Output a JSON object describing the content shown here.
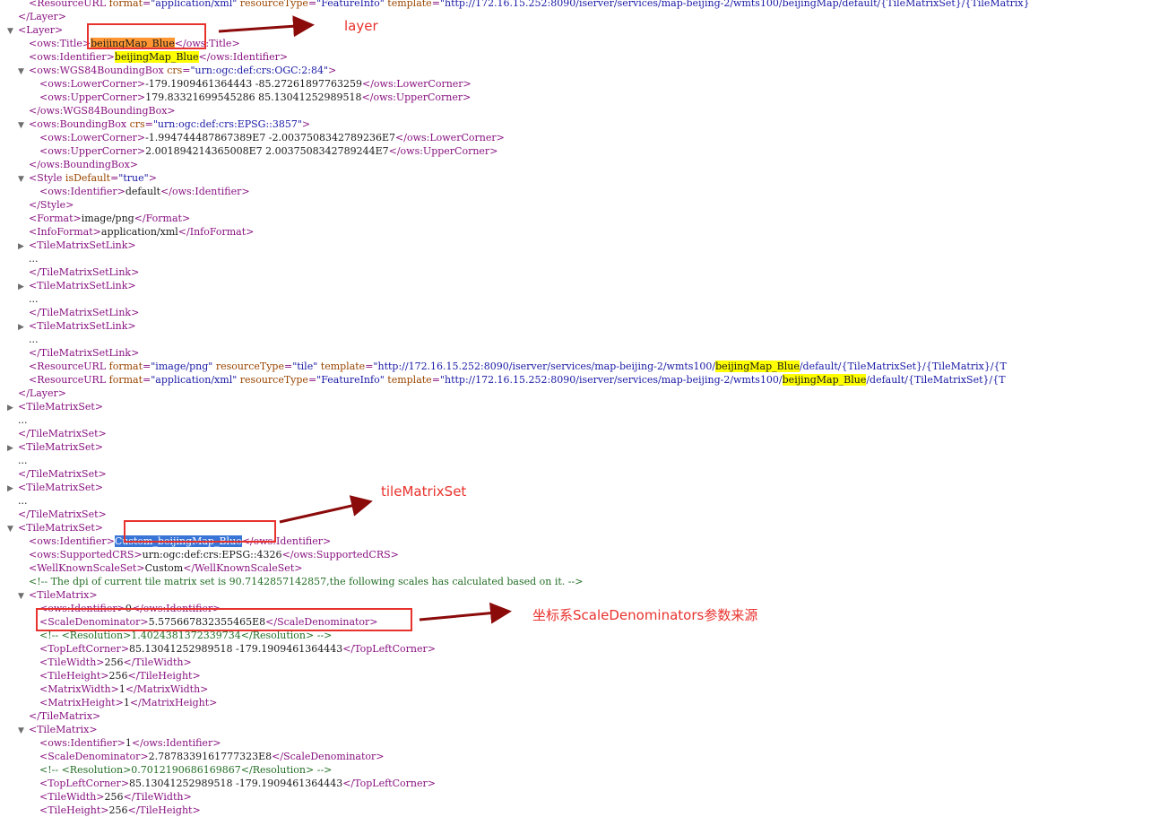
{
  "xml_lines": [
    {
      "indent": 2,
      "toggle": "",
      "parts": [
        [
          "tg",
          "<ResourceURL "
        ],
        [
          "an",
          "format"
        ],
        [
          "tg",
          "="
        ],
        [
          "av",
          "\"application/xml\""
        ],
        [
          "tg",
          " "
        ],
        [
          "an",
          "resourceType"
        ],
        [
          "tg",
          "="
        ],
        [
          "av",
          "\"FeatureInfo\""
        ],
        [
          "tg",
          " "
        ],
        [
          "an",
          "template"
        ],
        [
          "tg",
          "="
        ],
        [
          "av",
          "\"http://172.16.15.252:8090/iserver/services/map-beijing-2/wmts100/beijingMap/default/{TileMatrixSet}/{TileMatrix}"
        ]
      ]
    },
    {
      "indent": 1,
      "toggle": "",
      "parts": [
        [
          "tg",
          "</Layer>"
        ]
      ]
    },
    {
      "indent": 1,
      "toggle": "open",
      "parts": [
        [
          "tg",
          "<Layer>"
        ]
      ]
    },
    {
      "indent": 2,
      "toggle": "",
      "parts": [
        [
          "tg",
          "<ows:Title>"
        ],
        [
          "hl-o",
          "beijingMap_Blue"
        ],
        [
          "tg",
          "</ows:Title>"
        ]
      ]
    },
    {
      "indent": 2,
      "toggle": "",
      "parts": [
        [
          "tg",
          "<ows:Identifier>"
        ],
        [
          "hl-y",
          "beijingMap_Blue"
        ],
        [
          "tg",
          "</ows:Identifier>"
        ]
      ]
    },
    {
      "indent": 2,
      "toggle": "open",
      "parts": [
        [
          "tg",
          "<ows:WGS84BoundingBox "
        ],
        [
          "an",
          "crs"
        ],
        [
          "tg",
          "="
        ],
        [
          "av",
          "\"urn:ogc:def:crs:OGC:2:84\""
        ],
        [
          "tg",
          ">"
        ]
      ]
    },
    {
      "indent": 3,
      "toggle": "",
      "parts": [
        [
          "tg",
          "<ows:LowerCorner>"
        ],
        [
          "tx",
          "-179.1909461364443 -85.27261897763259"
        ],
        [
          "tg",
          "</ows:LowerCorner>"
        ]
      ]
    },
    {
      "indent": 3,
      "toggle": "",
      "parts": [
        [
          "tg",
          "<ows:UpperCorner>"
        ],
        [
          "tx",
          "179.83321699545286 85.13041252989518"
        ],
        [
          "tg",
          "</ows:UpperCorner>"
        ]
      ]
    },
    {
      "indent": 2,
      "toggle": "",
      "parts": [
        [
          "tg",
          "</ows:WGS84BoundingBox>"
        ]
      ]
    },
    {
      "indent": 2,
      "toggle": "open",
      "parts": [
        [
          "tg",
          "<ows:BoundingBox "
        ],
        [
          "an",
          "crs"
        ],
        [
          "tg",
          "="
        ],
        [
          "av",
          "\"urn:ogc:def:crs:EPSG::3857\""
        ],
        [
          "tg",
          ">"
        ]
      ]
    },
    {
      "indent": 3,
      "toggle": "",
      "parts": [
        [
          "tg",
          "<ows:LowerCorner>"
        ],
        [
          "tx",
          "-1.994744487867389E7 -2.0037508342789236E7"
        ],
        [
          "tg",
          "</ows:LowerCorner>"
        ]
      ]
    },
    {
      "indent": 3,
      "toggle": "",
      "parts": [
        [
          "tg",
          "<ows:UpperCorner>"
        ],
        [
          "tx",
          "2.001894214365008E7 2.0037508342789244E7"
        ],
        [
          "tg",
          "</ows:UpperCorner>"
        ]
      ]
    },
    {
      "indent": 2,
      "toggle": "",
      "parts": [
        [
          "tg",
          "</ows:BoundingBox>"
        ]
      ]
    },
    {
      "indent": 2,
      "toggle": "open",
      "parts": [
        [
          "tg",
          "<Style "
        ],
        [
          "an",
          "isDefault"
        ],
        [
          "tg",
          "="
        ],
        [
          "av",
          "\"true\""
        ],
        [
          "tg",
          ">"
        ]
      ]
    },
    {
      "indent": 3,
      "toggle": "",
      "parts": [
        [
          "tg",
          "<ows:Identifier>"
        ],
        [
          "tx",
          "default"
        ],
        [
          "tg",
          "</ows:Identifier>"
        ]
      ]
    },
    {
      "indent": 2,
      "toggle": "",
      "parts": [
        [
          "tg",
          "</Style>"
        ]
      ]
    },
    {
      "indent": 2,
      "toggle": "",
      "parts": [
        [
          "tg",
          "<Format>"
        ],
        [
          "tx",
          "image/png"
        ],
        [
          "tg",
          "</Format>"
        ]
      ]
    },
    {
      "indent": 2,
      "toggle": "",
      "parts": [
        [
          "tg",
          "<InfoFormat>"
        ],
        [
          "tx",
          "application/xml"
        ],
        [
          "tg",
          "</InfoFormat>"
        ]
      ]
    },
    {
      "indent": 2,
      "toggle": "closed",
      "parts": [
        [
          "tg",
          "<TileMatrixSetLink>"
        ]
      ]
    },
    {
      "indent": 2,
      "toggle": "",
      "parts": [
        [
          "tx",
          "..."
        ]
      ]
    },
    {
      "indent": 2,
      "toggle": "",
      "parts": [
        [
          "tg",
          "</TileMatrixSetLink>"
        ]
      ]
    },
    {
      "indent": 2,
      "toggle": "closed",
      "parts": [
        [
          "tg",
          "<TileMatrixSetLink>"
        ]
      ]
    },
    {
      "indent": 2,
      "toggle": "",
      "parts": [
        [
          "tx",
          "..."
        ]
      ]
    },
    {
      "indent": 2,
      "toggle": "",
      "parts": [
        [
          "tg",
          "</TileMatrixSetLink>"
        ]
      ]
    },
    {
      "indent": 2,
      "toggle": "closed",
      "parts": [
        [
          "tg",
          "<TileMatrixSetLink>"
        ]
      ]
    },
    {
      "indent": 2,
      "toggle": "",
      "parts": [
        [
          "tx",
          "..."
        ]
      ]
    },
    {
      "indent": 2,
      "toggle": "",
      "parts": [
        [
          "tg",
          "</TileMatrixSetLink>"
        ]
      ]
    },
    {
      "indent": 2,
      "toggle": "",
      "parts": [
        [
          "tg",
          "<ResourceURL "
        ],
        [
          "an",
          "format"
        ],
        [
          "tg",
          "="
        ],
        [
          "av",
          "\"image/png\""
        ],
        [
          "tg",
          " "
        ],
        [
          "an",
          "resourceType"
        ],
        [
          "tg",
          "="
        ],
        [
          "av",
          "\"tile\""
        ],
        [
          "tg",
          " "
        ],
        [
          "an",
          "template"
        ],
        [
          "tg",
          "="
        ],
        [
          "av",
          "\"http://172.16.15.252:8090/iserver/services/map-beijing-2/wmts100/"
        ],
        [
          "hl-y",
          "beijingMap_Blue"
        ],
        [
          "av",
          "/default/{TileMatrixSet}/{TileMatrix}/{T"
        ]
      ]
    },
    {
      "indent": 2,
      "toggle": "",
      "parts": [
        [
          "tg",
          "<ResourceURL "
        ],
        [
          "an",
          "format"
        ],
        [
          "tg",
          "="
        ],
        [
          "av",
          "\"application/xml\""
        ],
        [
          "tg",
          " "
        ],
        [
          "an",
          "resourceType"
        ],
        [
          "tg",
          "="
        ],
        [
          "av",
          "\"FeatureInfo\""
        ],
        [
          "tg",
          " "
        ],
        [
          "an",
          "template"
        ],
        [
          "tg",
          "="
        ],
        [
          "av",
          "\"http://172.16.15.252:8090/iserver/services/map-beijing-2/wmts100/"
        ],
        [
          "hl-y",
          "beijingMap_Blue"
        ],
        [
          "av",
          "/default/{TileMatrixSet}/{T"
        ]
      ]
    },
    {
      "indent": 1,
      "toggle": "",
      "parts": [
        [
          "tg",
          "</Layer>"
        ]
      ]
    },
    {
      "indent": 1,
      "toggle": "closed",
      "parts": [
        [
          "tg",
          "<TileMatrixSet>"
        ]
      ]
    },
    {
      "indent": 1,
      "toggle": "",
      "parts": [
        [
          "tx",
          "..."
        ]
      ]
    },
    {
      "indent": 1,
      "toggle": "",
      "parts": [
        [
          "tg",
          "</TileMatrixSet>"
        ]
      ]
    },
    {
      "indent": 1,
      "toggle": "closed",
      "parts": [
        [
          "tg",
          "<TileMatrixSet>"
        ]
      ]
    },
    {
      "indent": 1,
      "toggle": "",
      "parts": [
        [
          "tx",
          "..."
        ]
      ]
    },
    {
      "indent": 1,
      "toggle": "",
      "parts": [
        [
          "tg",
          "</TileMatrixSet>"
        ]
      ]
    },
    {
      "indent": 1,
      "toggle": "closed",
      "parts": [
        [
          "tg",
          "<TileMatrixSet>"
        ]
      ]
    },
    {
      "indent": 1,
      "toggle": "",
      "parts": [
        [
          "tx",
          "..."
        ]
      ]
    },
    {
      "indent": 1,
      "toggle": "",
      "parts": [
        [
          "tg",
          "</TileMatrixSet>"
        ]
      ]
    },
    {
      "indent": 1,
      "toggle": "open",
      "parts": [
        [
          "tg",
          "<TileMatrixSet>"
        ]
      ]
    },
    {
      "indent": 2,
      "toggle": "",
      "parts": [
        [
          "tg",
          "<ows:Identifier>"
        ],
        [
          "hl-b",
          "Custom_beijingMap_Blue"
        ],
        [
          "tg",
          "</ows:Identifier>"
        ]
      ]
    },
    {
      "indent": 2,
      "toggle": "",
      "parts": [
        [
          "tg",
          "<ows:SupportedCRS>"
        ],
        [
          "tx",
          "urn:ogc:def:crs:EPSG::4326"
        ],
        [
          "tg",
          "</ows:SupportedCRS>"
        ]
      ]
    },
    {
      "indent": 2,
      "toggle": "",
      "parts": [
        [
          "tg",
          "<WellKnownScaleSet>"
        ],
        [
          "tx",
          "Custom"
        ],
        [
          "tg",
          "</WellKnownScaleSet>"
        ]
      ]
    },
    {
      "indent": 2,
      "toggle": "",
      "parts": [
        [
          "cm",
          "<!-- The dpi of current tile matrix set is 90.7142857142857,the following scales has calculated based on it. -->"
        ]
      ]
    },
    {
      "indent": 2,
      "toggle": "open",
      "parts": [
        [
          "tg",
          "<TileMatrix>"
        ]
      ]
    },
    {
      "indent": 3,
      "toggle": "",
      "parts": [
        [
          "tg",
          "<ows:Identifier>"
        ],
        [
          "tx",
          "0"
        ],
        [
          "tg",
          "</ows:Identifier>"
        ]
      ]
    },
    {
      "indent": 3,
      "toggle": "",
      "parts": [
        [
          "tg",
          "<ScaleDenominator>"
        ],
        [
          "tx",
          "5.575667832355465E8"
        ],
        [
          "tg",
          "</ScaleDenominator>"
        ]
      ]
    },
    {
      "indent": 3,
      "toggle": "",
      "parts": [
        [
          "cm",
          "<!-- <Resolution>1.4024381372339734</Resolution> -->"
        ]
      ]
    },
    {
      "indent": 3,
      "toggle": "",
      "parts": [
        [
          "tg",
          "<TopLeftCorner>"
        ],
        [
          "tx",
          "85.13041252989518 -179.1909461364443"
        ],
        [
          "tg",
          "</TopLeftCorner>"
        ]
      ]
    },
    {
      "indent": 3,
      "toggle": "",
      "parts": [
        [
          "tg",
          "<TileWidth>"
        ],
        [
          "tx",
          "256"
        ],
        [
          "tg",
          "</TileWidth>"
        ]
      ]
    },
    {
      "indent": 3,
      "toggle": "",
      "parts": [
        [
          "tg",
          "<TileHeight>"
        ],
        [
          "tx",
          "256"
        ],
        [
          "tg",
          "</TileHeight>"
        ]
      ]
    },
    {
      "indent": 3,
      "toggle": "",
      "parts": [
        [
          "tg",
          "<MatrixWidth>"
        ],
        [
          "tx",
          "1"
        ],
        [
          "tg",
          "</MatrixWidth>"
        ]
      ]
    },
    {
      "indent": 3,
      "toggle": "",
      "parts": [
        [
          "tg",
          "<MatrixHeight>"
        ],
        [
          "tx",
          "1"
        ],
        [
          "tg",
          "</MatrixHeight>"
        ]
      ]
    },
    {
      "indent": 2,
      "toggle": "",
      "parts": [
        [
          "tg",
          "</TileMatrix>"
        ]
      ]
    },
    {
      "indent": 2,
      "toggle": "open",
      "parts": [
        [
          "tg",
          "<TileMatrix>"
        ]
      ]
    },
    {
      "indent": 3,
      "toggle": "",
      "parts": [
        [
          "tg",
          "<ows:Identifier>"
        ],
        [
          "tx",
          "1"
        ],
        [
          "tg",
          "</ows:Identifier>"
        ]
      ]
    },
    {
      "indent": 3,
      "toggle": "",
      "parts": [
        [
          "tg",
          "<ScaleDenominator>"
        ],
        [
          "tx",
          "2.7878339161777323E8"
        ],
        [
          "tg",
          "</ScaleDenominator>"
        ]
      ]
    },
    {
      "indent": 3,
      "toggle": "",
      "parts": [
        [
          "cm",
          "<!-- <Resolution>0.7012190686169867</Resolution> -->"
        ]
      ]
    },
    {
      "indent": 3,
      "toggle": "",
      "parts": [
        [
          "tg",
          "<TopLeftCorner>"
        ],
        [
          "tx",
          "85.13041252989518 -179.1909461364443"
        ],
        [
          "tg",
          "</TopLeftCorner>"
        ]
      ]
    },
    {
      "indent": 3,
      "toggle": "",
      "parts": [
        [
          "tg",
          "<TileWidth>"
        ],
        [
          "tx",
          "256"
        ],
        [
          "tg",
          "</TileWidth>"
        ]
      ]
    },
    {
      "indent": 3,
      "toggle": "",
      "parts": [
        [
          "tg",
          "<TileHeight>"
        ],
        [
          "tx",
          "256"
        ],
        [
          "tg",
          "</TileHeight>"
        ]
      ]
    }
  ],
  "annotations": {
    "layer_label": "layer",
    "tilematrixset_label": "tileMatrixSet",
    "scale_label": "坐标系ScaleDenominators参数来源"
  },
  "colors": {
    "tag": "#881280",
    "attribute_name": "#994500",
    "attribute_value": "#1a1aa6",
    "comment": "#236e25",
    "highlight_yellow": "#ffff00",
    "highlight_orange": "#ff9632",
    "highlight_blue": "#3875d7",
    "annotation_red": "#e8322d",
    "arrow_dark_red": "#8b0a0a"
  },
  "icons": {
    "toggle_open": "▼",
    "toggle_closed": "▶"
  }
}
